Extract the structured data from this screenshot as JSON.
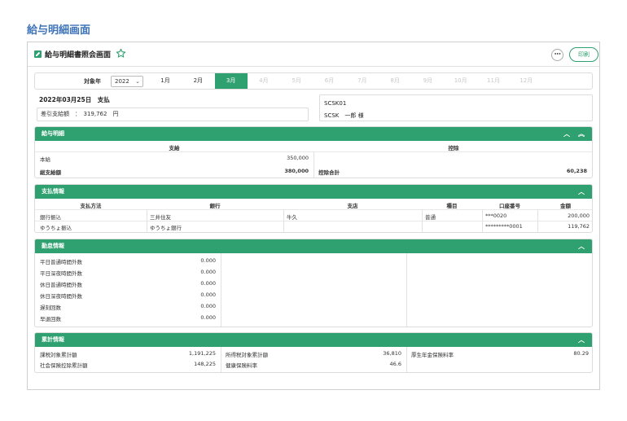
{
  "page_title": "給与明細画面",
  "window": {
    "title": "給与明細書照会画面",
    "print_label": "印刷",
    "more_label": "•••"
  },
  "filter": {
    "year_label": "対象年",
    "year_value": "2022",
    "months": [
      {
        "label": "1月",
        "state": "enabled"
      },
      {
        "label": "2月",
        "state": "enabled"
      },
      {
        "label": "3月",
        "state": "active"
      },
      {
        "label": "4月",
        "state": "disabled"
      },
      {
        "label": "5月",
        "state": "disabled"
      },
      {
        "label": "6月",
        "state": "disabled"
      },
      {
        "label": "7月",
        "state": "disabled"
      },
      {
        "label": "8月",
        "state": "disabled"
      },
      {
        "label": "9月",
        "state": "disabled"
      },
      {
        "label": "10月",
        "state": "disabled"
      },
      {
        "label": "11月",
        "state": "disabled"
      },
      {
        "label": "12月",
        "state": "disabled"
      }
    ]
  },
  "summary": {
    "payday": "2022年03月25日　支払",
    "net_pay": "差引支給額　：　319,762　円",
    "employee_code": "SCSK01",
    "employee_name": "SCSK　一郎 様"
  },
  "salary": {
    "header": "給与明細",
    "pay_col": "支給",
    "deduct_col": "控除",
    "items": [
      {
        "label": "本給",
        "value": "350,000"
      }
    ],
    "total_pay_label": "総支給額",
    "total_pay_value": "380,000",
    "total_deduct_label": "控除合計",
    "total_deduct_value": "60,238"
  },
  "payment": {
    "header": "支払情報",
    "columns": [
      "支払方法",
      "銀行",
      "支店",
      "種目",
      "口座番号",
      "金額"
    ],
    "rows": [
      [
        "銀行振込",
        "三井住友",
        "牛久",
        "普通",
        "***0020",
        "200,000"
      ],
      [
        "ゆうちょ振込",
        "ゆうちょ銀行",
        "",
        "",
        "*********0001",
        "119,762"
      ]
    ]
  },
  "attendance": {
    "header": "勤怠情報",
    "rows": [
      {
        "label": "平日普通時間外数",
        "value": "0.000"
      },
      {
        "label": "平日深夜時間外数",
        "value": "0.000"
      },
      {
        "label": "休日普通時間外数",
        "value": "0.000"
      },
      {
        "label": "休日深夜時間外数",
        "value": "0.000"
      },
      {
        "label": "遅刻回数",
        "value": "0.000"
      },
      {
        "label": "早退回数",
        "value": "0.000"
      }
    ]
  },
  "cumulative": {
    "header": "累計情報",
    "rows": [
      [
        {
          "label": "課税対象累計額",
          "value": "1,191,225"
        },
        {
          "label": "所得税対象累計額",
          "value": "36,810"
        },
        {
          "label": "厚生年金保険料率",
          "value": "80.29"
        }
      ],
      [
        {
          "label": "社会保険控除累計額",
          "value": "148,225"
        },
        {
          "label": "健康保険料率",
          "value": "46.6"
        },
        {
          "label": "",
          "value": ""
        }
      ]
    ]
  },
  "colors": {
    "accent": "#2fa06f",
    "title_blue": "#3f74b8"
  }
}
